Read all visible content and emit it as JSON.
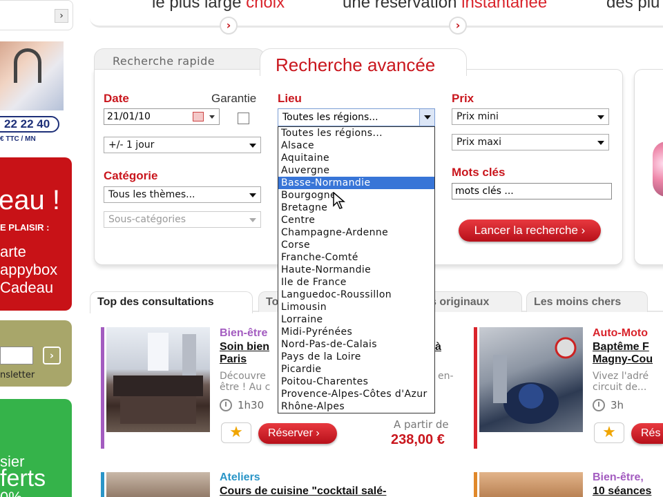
{
  "promo": {
    "items": [
      {
        "text": "le plus large ",
        "accent": "choix"
      },
      {
        "text": "une réservation ",
        "accent": "instantanée"
      },
      {
        "text": "des plu",
        "accent": ""
      }
    ]
  },
  "left": {
    "top_chevron": "›",
    "phone": "22 22 40",
    "phone_sub": "€ TTC / MN",
    "red_big": "eau !",
    "red_caps": "E PLAISIR :",
    "red_l1": "arte",
    "red_l2": "appybox",
    "red_l3": "Cadeau",
    "newsletter_btn": "›",
    "newsletter_label": "nsletter",
    "green_s1": "sier",
    "green_s2": "ferts",
    "green_s3": "0%"
  },
  "search": {
    "tab_rapide": "Recherche rapide",
    "tab_avancee": "Recherche avancée",
    "date_label": "Date",
    "garantie_label": "Garantie",
    "date_value": "21/01/10",
    "range_value": "+/- 1 jour",
    "categorie_label": "Catégorie",
    "categorie_value": "Tous les thèmes...",
    "souscat_value": "Sous-catégories",
    "lieu_label": "Lieu",
    "lieu_value": "Toutes les régions...",
    "prix_label": "Prix",
    "prix_mini": "Prix mini",
    "prix_maxi": "Prix maxi",
    "mots_label": "Mots clés",
    "mots_value": "mots clés ...",
    "launch": "Lancer la recherche ›"
  },
  "regions": [
    "Toutes les régions...",
    "Alsace",
    "Aquitaine",
    "Auvergne",
    "Basse-Normandie",
    "Bourgogne",
    "Bretagne",
    "Centre",
    "Champagne-Ardenne",
    "Corse",
    "Franche-Comté",
    "Haute-Normandie",
    "Ile de France",
    "Languedoc-Roussillon",
    "Limousin",
    "Lorraine",
    "Midi-Pyrénées",
    "Nord-Pas-de-Calais",
    "Pays de la Loire",
    "Picardie",
    "Poitou-Charentes",
    "Provence-Alpes-Côtes d'Azur",
    "Rhône-Alpes"
  ],
  "selected_region_index": 4,
  "tabs": {
    "top": "Top des consultations",
    "t2": "To",
    "t3": "s originaux",
    "t4": "Les moins chers"
  },
  "cards": {
    "c1_cat": "Bien-être",
    "c1_title1": "Soin bien",
    "c1_title1b": "à",
    "c1_title2": "Paris",
    "c1_desc1": "Découvre",
    "c1_desc1b": "en-",
    "c1_desc2": "être ! Au c",
    "c1_dur": "1h30",
    "c1_reserve": "Réserver ›",
    "c1_from": "A partir de",
    "c1_price": "238,00 €",
    "c2_cat": "Auto-Moto",
    "c2_title1": "Baptême F",
    "c2_title2": "Magny-Cou",
    "c2_desc1": "Vivez l'adré",
    "c2_desc2": "circuit de...",
    "c2_dur": "3h",
    "c2_reserve": "Rés",
    "c3_cat": "Ateliers",
    "c3_title": "Cours de cuisine \"cocktail salé-",
    "c4_cat": "Bien-être,",
    "c4_title": "10 séances"
  },
  "colors": {
    "accent": "#c9161d",
    "selection": "#3875d7",
    "bar_wellness": "#a35cc0",
    "bar_auto": "#d9242c",
    "bar_ateliers": "#2a95c7",
    "bar_bien": "#e0882a"
  }
}
